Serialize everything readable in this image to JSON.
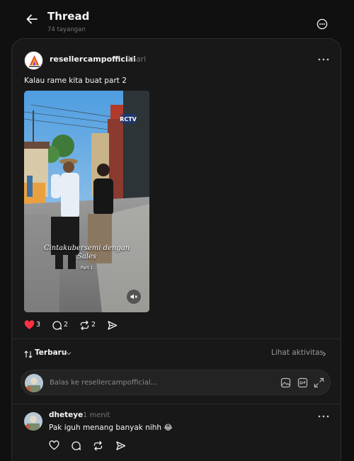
{
  "header": {
    "title": "Thread",
    "views": "74 tayangan"
  },
  "post": {
    "username": "resellercampofficial",
    "time": "1hari",
    "text": "Kalau rame kita buat part 2",
    "video": {
      "overlay_title_line1": "Cintakubersemi dengan",
      "overlay_title_line2": "Sales",
      "overlay_part": "Part 1",
      "watermark": "RCTV"
    },
    "likes": "3",
    "comments": "2",
    "reposts": "2"
  },
  "filters": {
    "sort_label": "Terbaru",
    "activity_label": "Lihat aktivitas"
  },
  "reply": {
    "placeholder": "Balas ke resellercampofficial..."
  },
  "comment": {
    "username": "dheteye",
    "time": "1 menit",
    "text": "Pak iguh menang banyak nihh 😂"
  },
  "colors": {
    "background": "#101010",
    "card": "#181818",
    "like_red": "#ff3040",
    "muted": "#777777"
  }
}
